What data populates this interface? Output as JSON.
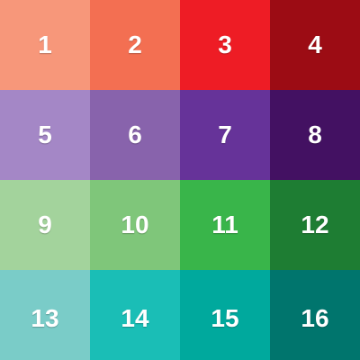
{
  "board": {
    "tiles": [
      {
        "label": "1",
        "color": "#F7977A"
      },
      {
        "label": "2",
        "color": "#F36F52"
      },
      {
        "label": "3",
        "color": "#EE1C25"
      },
      {
        "label": "4",
        "color": "#9C0C14"
      },
      {
        "label": "5",
        "color": "#A487C6"
      },
      {
        "label": "6",
        "color": "#8863AC"
      },
      {
        "label": "7",
        "color": "#663399"
      },
      {
        "label": "8",
        "color": "#431162"
      },
      {
        "label": "9",
        "color": "#A3D39C"
      },
      {
        "label": "10",
        "color": "#7FC67A"
      },
      {
        "label": "11",
        "color": "#39B54A"
      },
      {
        "label": "12",
        "color": "#1E7D33"
      },
      {
        "label": "13",
        "color": "#7ACCC8"
      },
      {
        "label": "14",
        "color": "#1ABEB6"
      },
      {
        "label": "15",
        "color": "#00A99D"
      },
      {
        "label": "16",
        "color": "#00756D"
      }
    ]
  }
}
